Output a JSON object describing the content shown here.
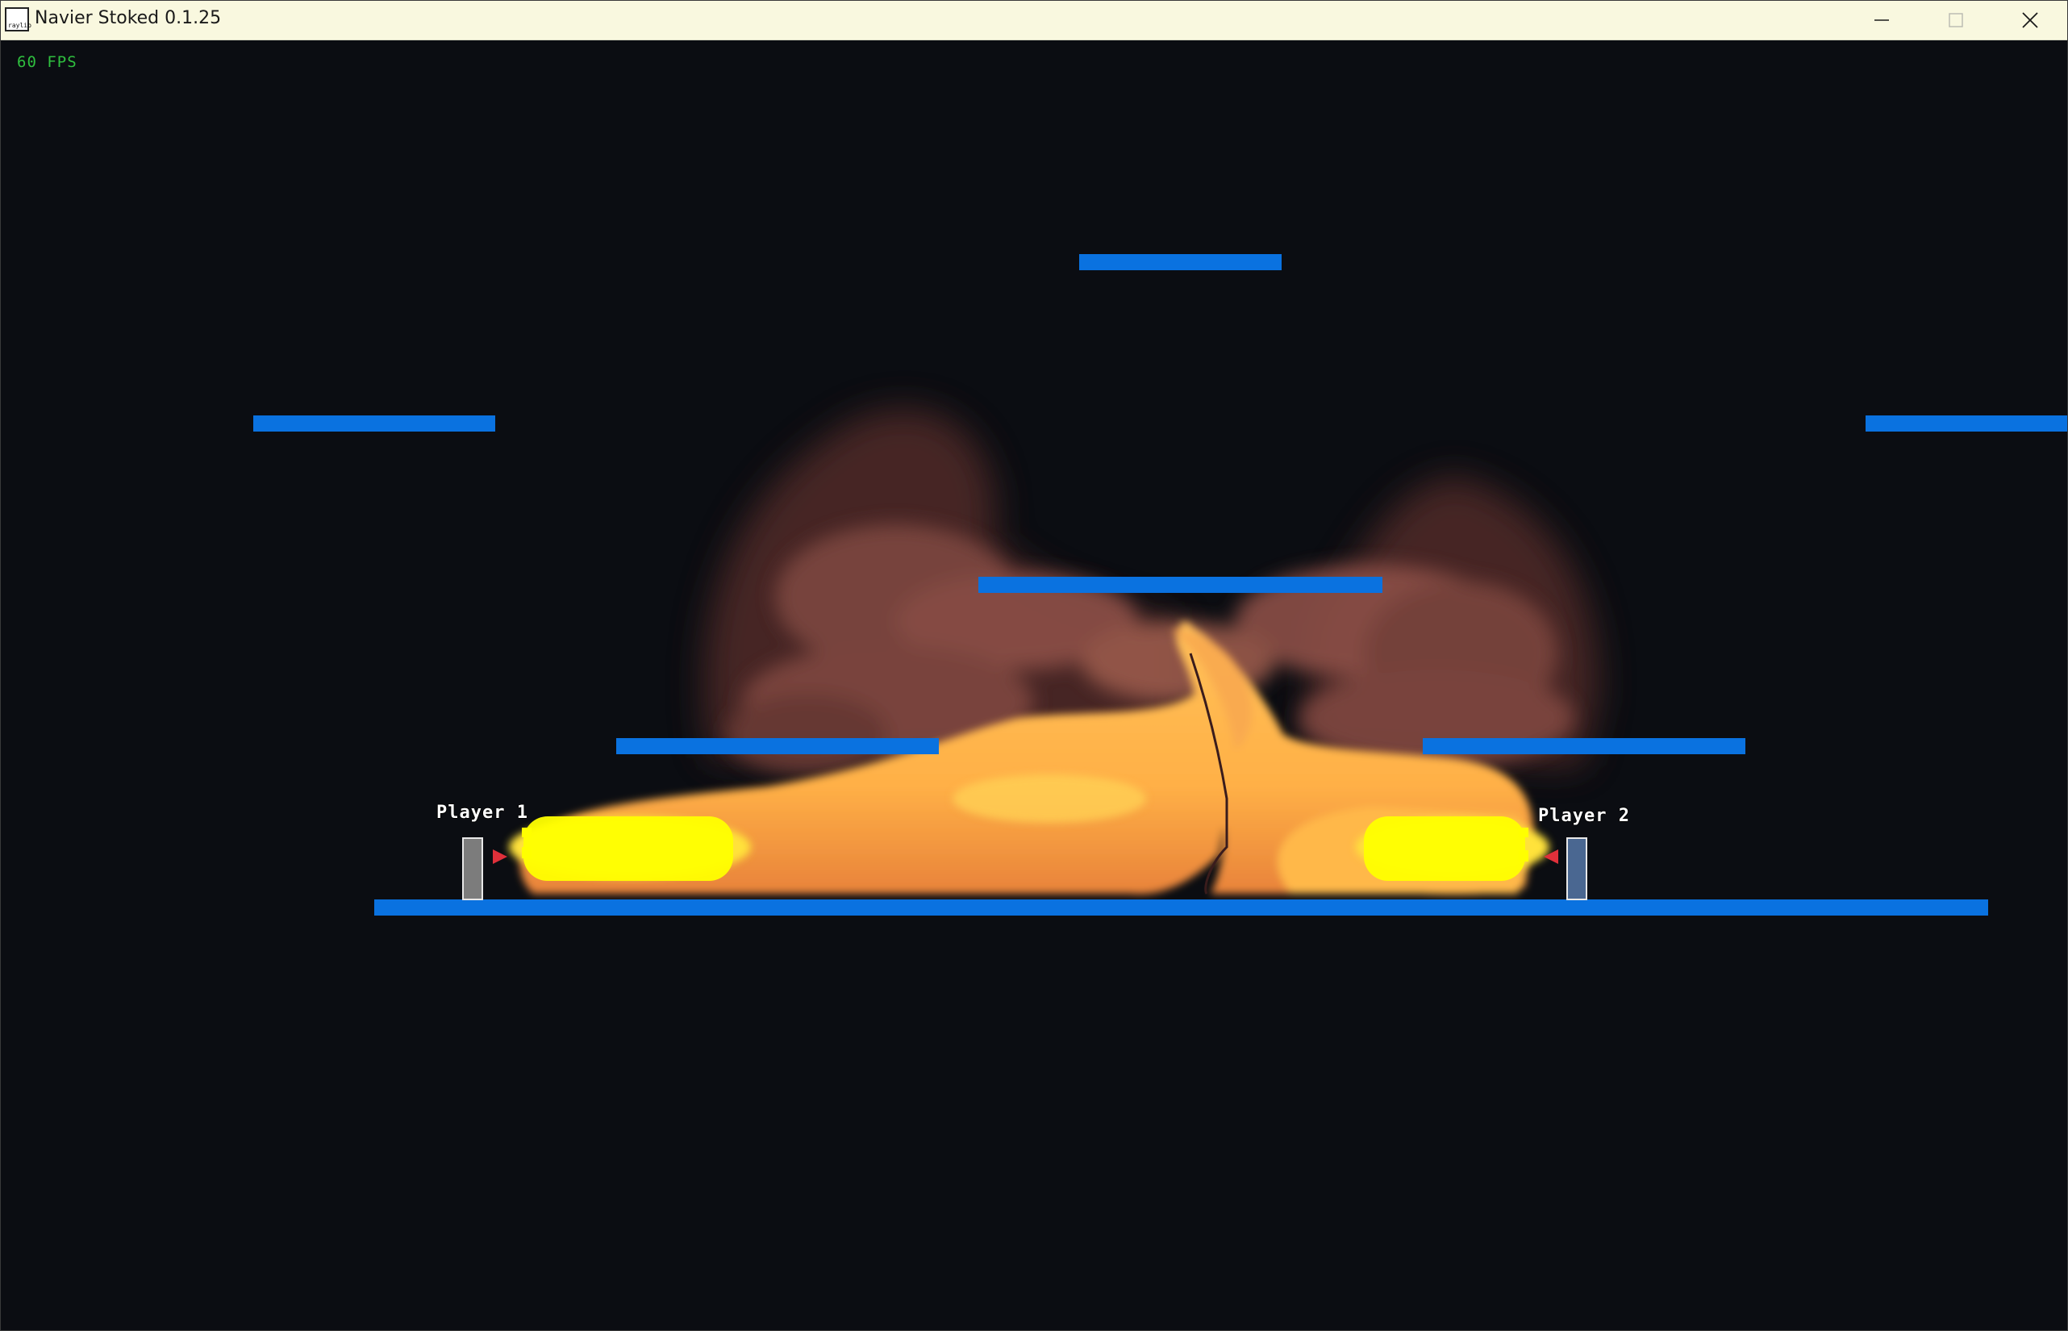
{
  "window": {
    "title": "Navier Stoked 0.1.25",
    "icon_text": "raylib",
    "icon": "raylib-app-icon",
    "controls": [
      "minimize-icon",
      "maximize-icon",
      "close-icon"
    ]
  },
  "hud": {
    "fps": "60 FPS",
    "fps_color": "#2fbf3f"
  },
  "players": [
    {
      "label": "Player 1",
      "color": "#7c7c7c",
      "facing": "right"
    },
    {
      "label": "Player 2",
      "color": "#4a6791",
      "facing": "left"
    }
  ],
  "colors": {
    "background": "#0b0d12",
    "platform": "#0a72e0",
    "fire_core": "#ffff00",
    "fire_mid": "#ffb347",
    "smoke": "#8a4f45",
    "aim_arrow": "#e0303a"
  }
}
